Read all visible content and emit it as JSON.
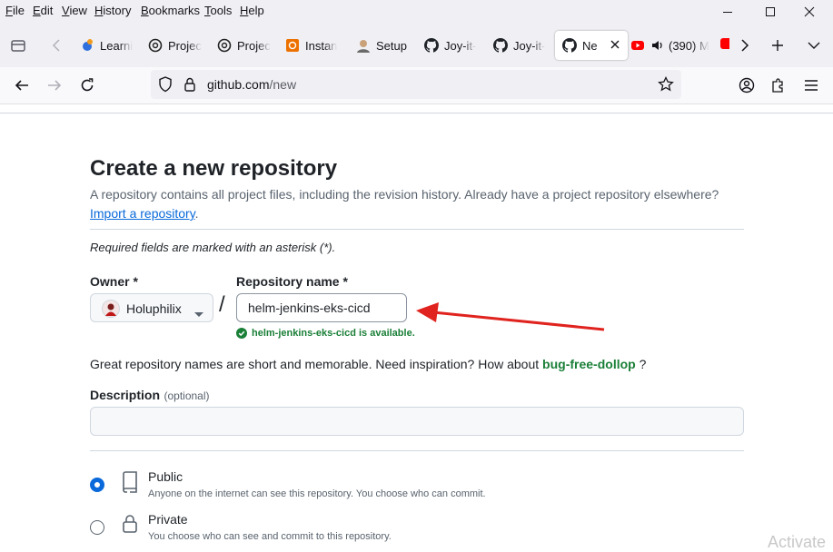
{
  "menu": [
    "File",
    "Edit",
    "View",
    "History",
    "Bookmarks",
    "Tools",
    "Help"
  ],
  "menu_access_keys": [
    "F",
    "E",
    "V",
    "H",
    "B",
    "T",
    "H"
  ],
  "tabs": [
    {
      "label": "Learni",
      "icon": "learn-icon"
    },
    {
      "label": "Projec",
      "icon": "openai-icon"
    },
    {
      "label": "Projec",
      "icon": "openai-icon"
    },
    {
      "label": "Instan",
      "icon": "aws-icon"
    },
    {
      "label": "Setup",
      "icon": "avatar-icon"
    },
    {
      "label": "Joy-it-",
      "icon": "github-icon"
    },
    {
      "label": "Joy-it-",
      "icon": "github-icon"
    },
    {
      "label": "Ne",
      "icon": "github-icon",
      "active": true
    },
    {
      "label": "(390) M",
      "icon": "youtube-icon"
    }
  ],
  "address": {
    "host": "github.com",
    "path": "/new"
  },
  "page": {
    "title": "Create a new repository",
    "subtitle": "A repository contains all project files, including the revision history. Already have a project repository elsewhere?",
    "import_link": "Import a repository",
    "import_period": ".",
    "required_note": "Required fields are marked with an asterisk (*).",
    "owner_label": "Owner *",
    "owner_value": "Holuphilix",
    "slash": "/",
    "repo_label": "Repository name *",
    "repo_value": "helm-jenkins-eks-cicd",
    "availability": "helm-jenkins-eks-cicd is available.",
    "inspiration_prefix": "Great repository names are short and memorable. Need inspiration? How about",
    "inspiration_name": "bug-free-dollop",
    "inspiration_suffix": "?",
    "description_label": "Description",
    "description_optional": "(optional)",
    "description_value": "",
    "visibility": [
      {
        "label": "Public",
        "desc": "Anyone on the internet can see this repository. You choose who can commit.",
        "selected": true
      },
      {
        "label": "Private",
        "desc": "You choose who can see and commit to this repository.",
        "selected": false
      }
    ]
  },
  "watermark": "Activate",
  "colors": {
    "accent": "#0969da",
    "success": "#1a7f37",
    "arrow": "#e0231e",
    "chrome": "#f0f0f4"
  }
}
